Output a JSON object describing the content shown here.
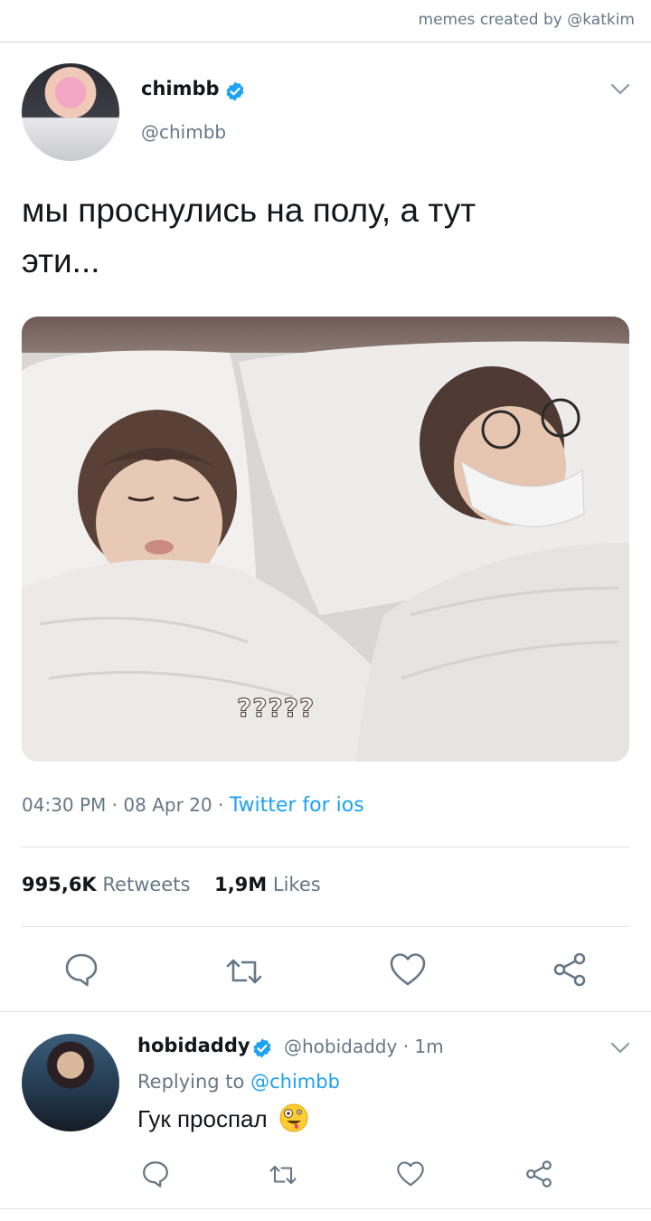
{
  "credit": "memes created by @katkim",
  "tweet": {
    "name": "chimbb",
    "handle": "@chimbb",
    "text_line1": "мы проснулись на полу, а тут",
    "text_line2": "эти...",
    "media_caption": "?????",
    "time": "04:30 PM",
    "date": "08 Apr 20",
    "source": "Twitter for ios",
    "retweets_count": "995,6K",
    "retweets_label": "Retweets",
    "likes_count": "1,9M",
    "likes_label": "Likes"
  },
  "reply": {
    "name": "hobidaddy",
    "handle": "@hobidaddy",
    "time": "1m",
    "replying_label": "Replying to",
    "replying_to": "@chimbb",
    "text": "Гук проспал"
  },
  "colors": {
    "accent": "#1da1f2",
    "secondary_text": "#657786",
    "primary_text": "#14171a"
  },
  "icons": [
    "verified-icon",
    "chevron-down-icon",
    "reply-icon",
    "retweet-icon",
    "like-icon",
    "share-icon",
    "zany-face-emoji"
  ]
}
